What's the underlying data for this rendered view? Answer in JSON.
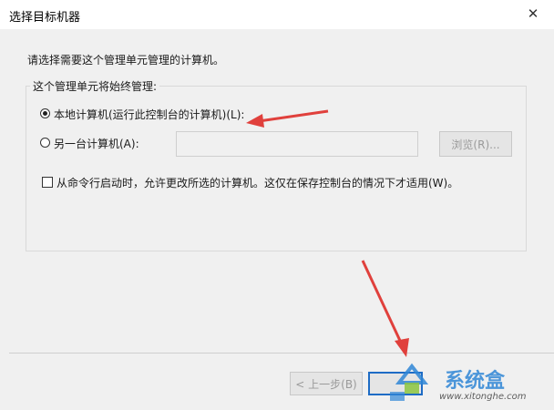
{
  "window": {
    "title": "选择目标机器",
    "close_glyph": "✕"
  },
  "dialog": {
    "instruction": "请选择需要这个管理单元管理的计算机。",
    "group_title": "这个管理单元将始终管理:",
    "options": {
      "local": {
        "label": "本地计算机(运行此控制台的计算机)(L):",
        "selected": true
      },
      "another": {
        "label": "另一台计算机(A):",
        "selected": false,
        "value": ""
      }
    },
    "browse_button": "浏览(R)...",
    "allow_change_checkbox": {
      "label": "从命令行启动时，允许更改所选的计算机。这仅在保存控制台的情况下才适用(W)。",
      "checked": false
    }
  },
  "footer": {
    "back_button": "< 上一步(B)"
  },
  "watermark": {
    "name": "系统盒",
    "url": "www.xitonghe.com"
  },
  "colors": {
    "arrow": "#e0403c",
    "focus": "#1e6cc5",
    "watermark": "#2f86d6"
  },
  "icons": [
    "close-icon",
    "radio-checked-icon",
    "radio-unchecked-icon",
    "checkbox-icon",
    "watermark-logo-icon"
  ]
}
